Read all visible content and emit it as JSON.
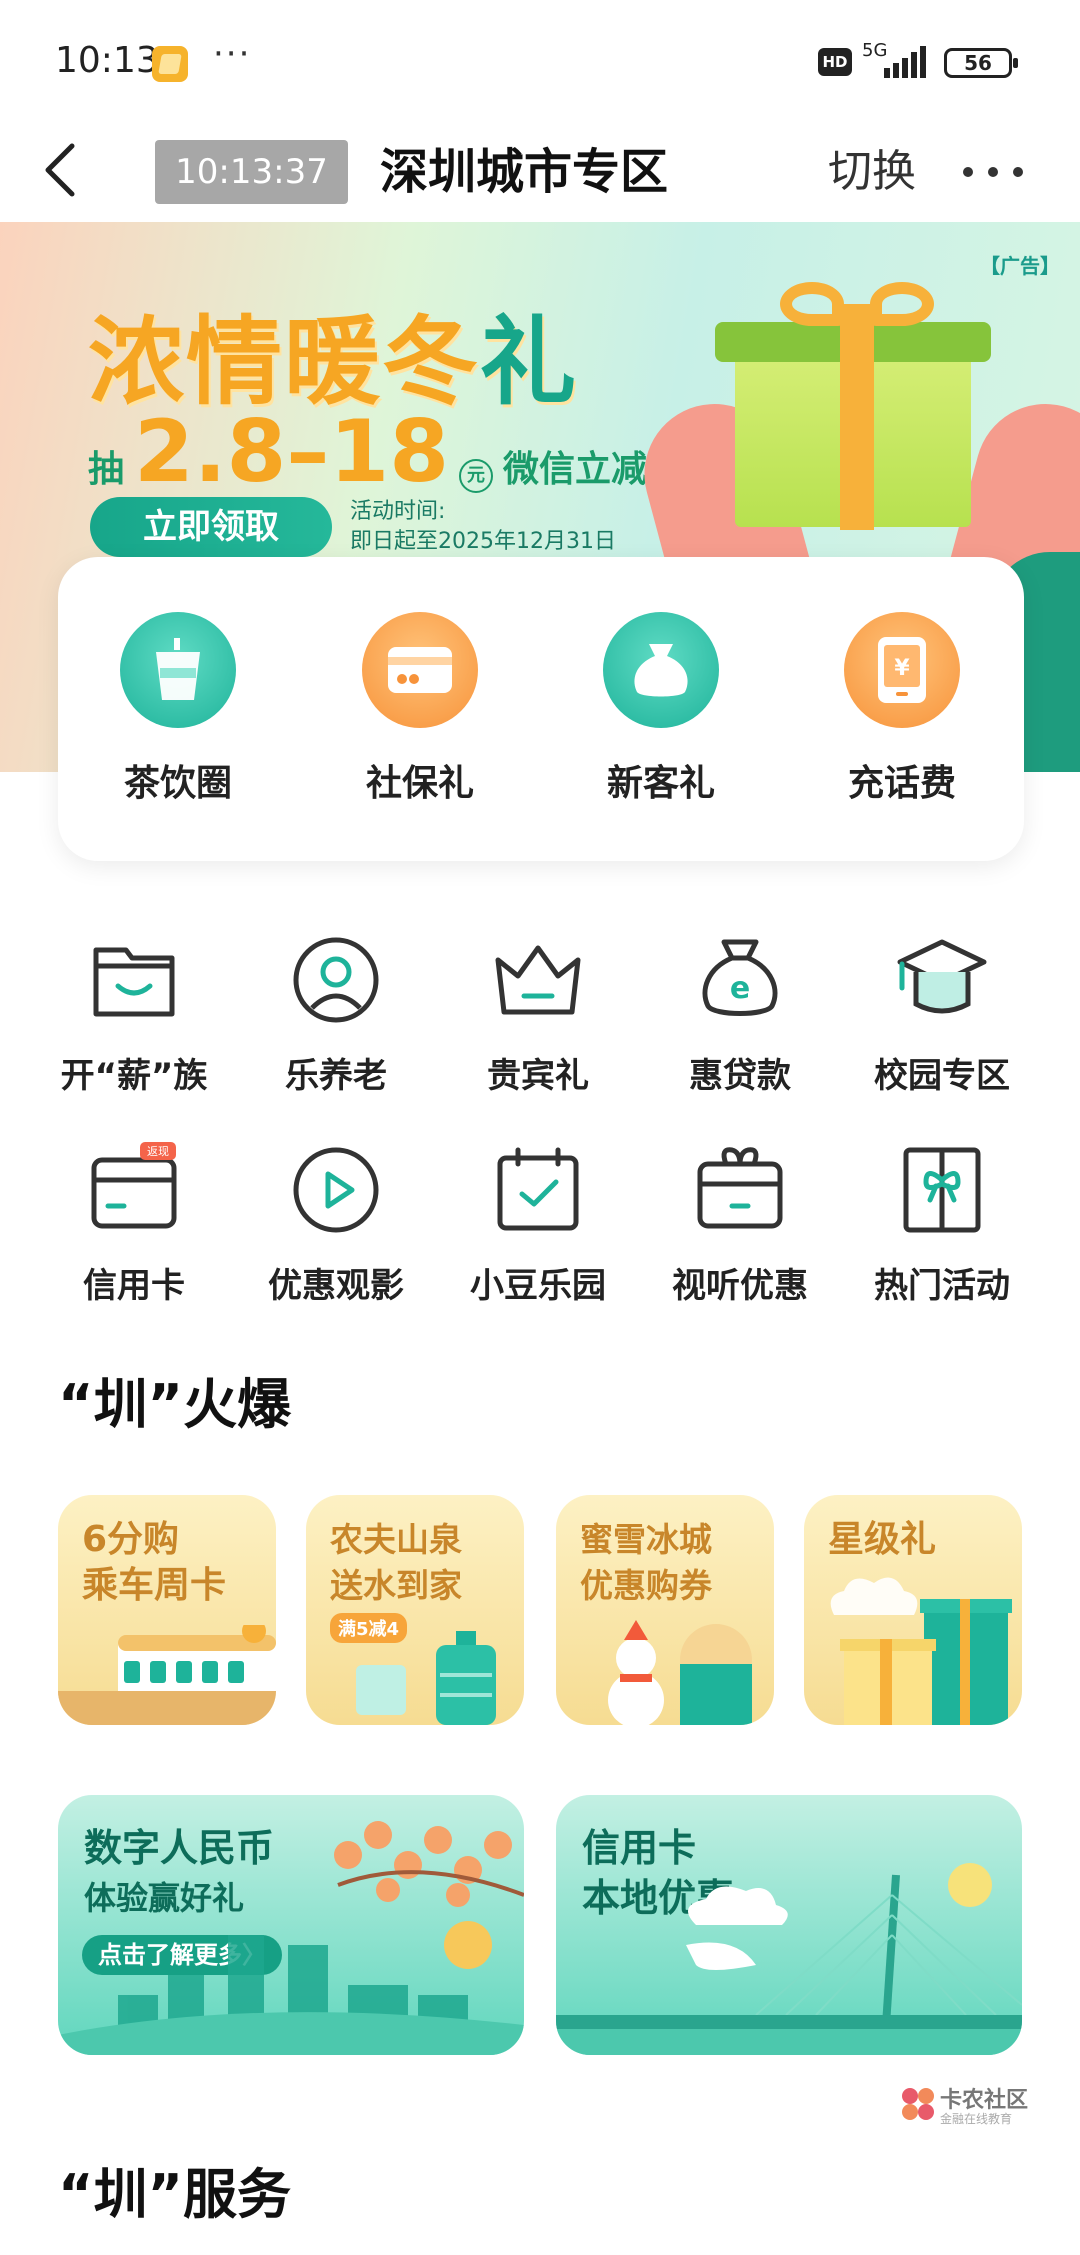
{
  "status_bar": {
    "time": "10:13",
    "hd": "HD",
    "network": "5G",
    "battery": "56"
  },
  "nav": {
    "clock": "10:13:37",
    "title": "深圳城市专区",
    "switch_label": "切换"
  },
  "banner": {
    "ad_tag": "【广告】",
    "title_main": "浓情暖冬",
    "title_last": "礼",
    "sub_prefix": "抽",
    "amount": "2.8–18",
    "yuan": "元",
    "sub_suffix": "微信立减金",
    "button": "立即领取",
    "time_label": "活动时间:",
    "time_value": "即日起至2025年12月31日"
  },
  "quick_items": [
    {
      "label": "茶饮圈",
      "icon": "cup-icon",
      "color": "#1eb39a"
    },
    {
      "label": "社保礼",
      "icon": "card-icon",
      "color": "#f7933a"
    },
    {
      "label": "新客礼",
      "icon": "bag-icon",
      "color": "#1eb39a"
    },
    {
      "label": "充话费",
      "icon": "phone-icon",
      "color": "#f7933a"
    }
  ],
  "grid_row1": [
    {
      "label": "开“薪”族",
      "icon": "wallet-icon"
    },
    {
      "label": "乐养老",
      "icon": "person-icon"
    },
    {
      "label": "贵宾礼",
      "icon": "crown-icon"
    },
    {
      "label": "惠贷款",
      "icon": "money-bag-icon"
    },
    {
      "label": "校园专区",
      "icon": "graduation-cap-icon"
    }
  ],
  "grid_row2": [
    {
      "label": "信用卡",
      "icon": "credit-card-icon",
      "badge": "返现"
    },
    {
      "label": "优惠观影",
      "icon": "play-icon"
    },
    {
      "label": "小豆乐园",
      "icon": "calendar-check-icon"
    },
    {
      "label": "视听优惠",
      "icon": "gift-box-icon"
    },
    {
      "label": "热门活动",
      "icon": "ribbon-icon"
    }
  ],
  "section_hot": "“圳”火爆",
  "promos": [
    {
      "line1": "6分购",
      "line2": "乘车周卡",
      "color": "#c8862a"
    },
    {
      "line1": "农夫山泉",
      "line2": "送水到家",
      "color": "#c8862a",
      "tag": "满5减4"
    },
    {
      "line1": "蜜雪冰城",
      "line2": "优惠购券",
      "color": "#c8862a"
    },
    {
      "line1": "星级礼",
      "line2": "",
      "color": "#c8862a"
    }
  ],
  "big_promos": [
    {
      "line1": "数字人民币",
      "line2": "体验赢好礼",
      "pill": "点击了解更多〉"
    },
    {
      "line1": "信用卡",
      "line2": "本地优惠"
    }
  ],
  "section_service": "“圳”服务",
  "watermark": {
    "title": "卡农社区",
    "subtitle": "金融在线教育"
  }
}
